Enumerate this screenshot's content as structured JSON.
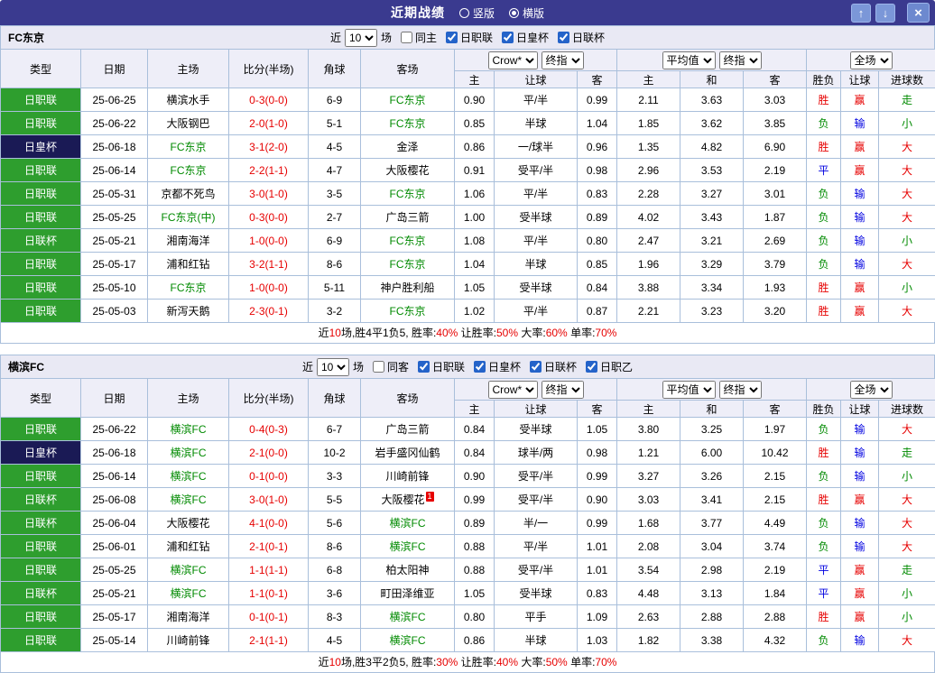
{
  "colors": {
    "red": "#e60000",
    "green": "#008a00",
    "blue": "#0000e0",
    "black": "#000000",
    "titlebar_bg": "#3a3a8f",
    "league_green_bg": "#2e9e2e",
    "league_dark_bg": "#1a1a55",
    "highlight_team": "#008a00"
  },
  "titlebar": {
    "title": "近期战绩",
    "layout_options": [
      {
        "label": "竖版",
        "selected": false
      },
      {
        "label": "横版",
        "selected": true
      }
    ],
    "up_icon": "↑",
    "down_icon": "↓",
    "close_icon": "×"
  },
  "table_headers": {
    "type": "类型",
    "date": "日期",
    "home": "主场",
    "score": "比分(半场)",
    "corner": "角球",
    "away": "客场",
    "odds_sub": [
      "主",
      "让球",
      "客"
    ],
    "avg_sub": [
      "主",
      "和",
      "客"
    ],
    "full_sub": [
      "胜负",
      "让球",
      "进球数"
    ]
  },
  "sections": [
    {
      "team": "FC东京",
      "filter": {
        "near_label": "近",
        "count": "10",
        "games_label": "场",
        "checkboxes": [
          {
            "label": "同主",
            "checked": false
          },
          {
            "label": "日职联",
            "checked": true
          },
          {
            "label": "日皇杯",
            "checked": true
          },
          {
            "label": "日联杯",
            "checked": true
          }
        ]
      },
      "selects": {
        "company": "Crow*",
        "company_mode": "终指",
        "avg": "平均值",
        "avg_mode": "终指",
        "scope": "全场"
      },
      "rows": [
        {
          "league": "日职联",
          "badge": "green",
          "date": "25-06-25",
          "home": "横滨水手",
          "home_hl": false,
          "score": "0-3(0-0)",
          "corner": "6-9",
          "away": "FC东京",
          "away_hl": true,
          "red": "",
          "odds": [
            "0.90",
            "平/半",
            "0.99"
          ],
          "avg": [
            "2.11",
            "3.63",
            "3.03"
          ],
          "results": [
            [
              "胜",
              "r"
            ],
            [
              "赢",
              "r"
            ],
            [
              "走",
              "g"
            ]
          ]
        },
        {
          "league": "日职联",
          "badge": "green",
          "date": "25-06-22",
          "home": "大阪钢巴",
          "home_hl": false,
          "score": "2-0(1-0)",
          "corner": "5-1",
          "away": "FC东京",
          "away_hl": true,
          "red": "",
          "odds": [
            "0.85",
            "半球",
            "1.04"
          ],
          "avg": [
            "1.85",
            "3.62",
            "3.85"
          ],
          "results": [
            [
              "负",
              "g"
            ],
            [
              "输",
              "b"
            ],
            [
              "小",
              "g"
            ]
          ]
        },
        {
          "league": "日皇杯",
          "badge": "dark",
          "date": "25-06-18",
          "home": "FC东京",
          "home_hl": true,
          "score": "3-1(2-0)",
          "corner": "4-5",
          "away": "金泽",
          "away_hl": false,
          "red": "",
          "odds": [
            "0.86",
            "一/球半",
            "0.96"
          ],
          "avg": [
            "1.35",
            "4.82",
            "6.90"
          ],
          "results": [
            [
              "胜",
              "r"
            ],
            [
              "赢",
              "r"
            ],
            [
              "大",
              "r"
            ]
          ]
        },
        {
          "league": "日职联",
          "badge": "green",
          "date": "25-06-14",
          "home": "FC东京",
          "home_hl": true,
          "score": "2-2(1-1)",
          "corner": "4-7",
          "away": "大阪樱花",
          "away_hl": false,
          "red": "",
          "odds": [
            "0.91",
            "受平/半",
            "0.98"
          ],
          "avg": [
            "2.96",
            "3.53",
            "2.19"
          ],
          "results": [
            [
              "平",
              "b"
            ],
            [
              "赢",
              "r"
            ],
            [
              "大",
              "r"
            ]
          ]
        },
        {
          "league": "日职联",
          "badge": "green",
          "date": "25-05-31",
          "home": "京都不死鸟",
          "home_hl": false,
          "score": "3-0(1-0)",
          "corner": "3-5",
          "away": "FC东京",
          "away_hl": true,
          "red": "",
          "odds": [
            "1.06",
            "平/半",
            "0.83"
          ],
          "avg": [
            "2.28",
            "3.27",
            "3.01"
          ],
          "results": [
            [
              "负",
              "g"
            ],
            [
              "输",
              "b"
            ],
            [
              "大",
              "r"
            ]
          ]
        },
        {
          "league": "日职联",
          "badge": "green",
          "date": "25-05-25",
          "home": "FC东京(中)",
          "home_hl": true,
          "score": "0-3(0-0)",
          "corner": "2-7",
          "away": "广岛三箭",
          "away_hl": false,
          "red": "",
          "odds": [
            "1.00",
            "受半球",
            "0.89"
          ],
          "avg": [
            "4.02",
            "3.43",
            "1.87"
          ],
          "results": [
            [
              "负",
              "g"
            ],
            [
              "输",
              "b"
            ],
            [
              "大",
              "r"
            ]
          ]
        },
        {
          "league": "日联杯",
          "badge": "green",
          "date": "25-05-21",
          "home": "湘南海洋",
          "home_hl": false,
          "score": "1-0(0-0)",
          "corner": "6-9",
          "away": "FC东京",
          "away_hl": true,
          "red": "",
          "odds": [
            "1.08",
            "平/半",
            "0.80"
          ],
          "avg": [
            "2.47",
            "3.21",
            "2.69"
          ],
          "results": [
            [
              "负",
              "g"
            ],
            [
              "输",
              "b"
            ],
            [
              "小",
              "g"
            ]
          ]
        },
        {
          "league": "日职联",
          "badge": "green",
          "date": "25-05-17",
          "home": "浦和红钻",
          "home_hl": false,
          "score": "3-2(1-1)",
          "corner": "8-6",
          "away": "FC东京",
          "away_hl": true,
          "red": "",
          "odds": [
            "1.04",
            "半球",
            "0.85"
          ],
          "avg": [
            "1.96",
            "3.29",
            "3.79"
          ],
          "results": [
            [
              "负",
              "g"
            ],
            [
              "输",
              "b"
            ],
            [
              "大",
              "r"
            ]
          ]
        },
        {
          "league": "日职联",
          "badge": "green",
          "date": "25-05-10",
          "home": "FC东京",
          "home_hl": true,
          "score": "1-0(0-0)",
          "corner": "5-11",
          "away": "神户胜利船",
          "away_hl": false,
          "red": "",
          "odds": [
            "1.05",
            "受半球",
            "0.84"
          ],
          "avg": [
            "3.88",
            "3.34",
            "1.93"
          ],
          "results": [
            [
              "胜",
              "r"
            ],
            [
              "赢",
              "r"
            ],
            [
              "小",
              "g"
            ]
          ]
        },
        {
          "league": "日职联",
          "badge": "green",
          "date": "25-05-03",
          "home": "新泻天鹅",
          "home_hl": false,
          "score": "2-3(0-1)",
          "corner": "3-2",
          "away": "FC东京",
          "away_hl": true,
          "red": "",
          "odds": [
            "1.02",
            "平/半",
            "0.87"
          ],
          "avg": [
            "2.21",
            "3.23",
            "3.20"
          ],
          "results": [
            [
              "胜",
              "r"
            ],
            [
              "赢",
              "r"
            ],
            [
              "大",
              "r"
            ]
          ]
        }
      ],
      "summary": [
        [
          "近",
          "k"
        ],
        [
          "10",
          "r"
        ],
        [
          "场,胜4平1负5, 胜率:",
          "k"
        ],
        [
          "40%",
          "r"
        ],
        [
          " 让胜率:",
          "k"
        ],
        [
          "50%",
          "r"
        ],
        [
          " 大率:",
          "k"
        ],
        [
          "60%",
          "r"
        ],
        [
          " 单率:",
          "k"
        ],
        [
          "70%",
          "r"
        ]
      ]
    },
    {
      "team": "横滨FC",
      "filter": {
        "near_label": "近",
        "count": "10",
        "games_label": "场",
        "checkboxes": [
          {
            "label": "同客",
            "checked": false
          },
          {
            "label": "日职联",
            "checked": true
          },
          {
            "label": "日皇杯",
            "checked": true
          },
          {
            "label": "日联杯",
            "checked": true
          },
          {
            "label": "日职乙",
            "checked": true
          }
        ]
      },
      "selects": {
        "company": "Crow*",
        "company_mode": "终指",
        "avg": "平均值",
        "avg_mode": "终指",
        "scope": "全场"
      },
      "rows": [
        {
          "league": "日职联",
          "badge": "green",
          "date": "25-06-22",
          "home": "横滨FC",
          "home_hl": true,
          "score": "0-4(0-3)",
          "corner": "6-7",
          "away": "广岛三箭",
          "away_hl": false,
          "red": "",
          "odds": [
            "0.84",
            "受半球",
            "1.05"
          ],
          "avg": [
            "3.80",
            "3.25",
            "1.97"
          ],
          "results": [
            [
              "负",
              "g"
            ],
            [
              "输",
              "b"
            ],
            [
              "大",
              "r"
            ]
          ]
        },
        {
          "league": "日皇杯",
          "badge": "dark",
          "date": "25-06-18",
          "home": "横滨FC",
          "home_hl": true,
          "score": "2-1(0-0)",
          "corner": "10-2",
          "away": "岩手盛冈仙鹤",
          "away_hl": false,
          "red": "",
          "odds": [
            "0.84",
            "球半/两",
            "0.98"
          ],
          "avg": [
            "1.21",
            "6.00",
            "10.42"
          ],
          "results": [
            [
              "胜",
              "r"
            ],
            [
              "输",
              "b"
            ],
            [
              "走",
              "g"
            ]
          ]
        },
        {
          "league": "日职联",
          "badge": "green",
          "date": "25-06-14",
          "home": "横滨FC",
          "home_hl": true,
          "score": "0-1(0-0)",
          "corner": "3-3",
          "away": "川崎前锋",
          "away_hl": false,
          "red": "",
          "odds": [
            "0.90",
            "受平/半",
            "0.99"
          ],
          "avg": [
            "3.27",
            "3.26",
            "2.15"
          ],
          "results": [
            [
              "负",
              "g"
            ],
            [
              "输",
              "b"
            ],
            [
              "小",
              "g"
            ]
          ]
        },
        {
          "league": "日联杯",
          "badge": "green",
          "date": "25-06-08",
          "home": "横滨FC",
          "home_hl": true,
          "score": "3-0(1-0)",
          "corner": "5-5",
          "away": "大阪樱花",
          "away_hl": false,
          "red": "1",
          "odds": [
            "0.99",
            "受平/半",
            "0.90"
          ],
          "avg": [
            "3.03",
            "3.41",
            "2.15"
          ],
          "results": [
            [
              "胜",
              "r"
            ],
            [
              "赢",
              "r"
            ],
            [
              "大",
              "r"
            ]
          ]
        },
        {
          "league": "日联杯",
          "badge": "green",
          "date": "25-06-04",
          "home": "大阪樱花",
          "home_hl": false,
          "score": "4-1(0-0)",
          "corner": "5-6",
          "away": "横滨FC",
          "away_hl": true,
          "red": "",
          "odds": [
            "0.89",
            "半/一",
            "0.99"
          ],
          "avg": [
            "1.68",
            "3.77",
            "4.49"
          ],
          "results": [
            [
              "负",
              "g"
            ],
            [
              "输",
              "b"
            ],
            [
              "大",
              "r"
            ]
          ]
        },
        {
          "league": "日职联",
          "badge": "green",
          "date": "25-06-01",
          "home": "浦和红钻",
          "home_hl": false,
          "score": "2-1(0-1)",
          "corner": "8-6",
          "away": "横滨FC",
          "away_hl": true,
          "red": "",
          "odds": [
            "0.88",
            "平/半",
            "1.01"
          ],
          "avg": [
            "2.08",
            "3.04",
            "3.74"
          ],
          "results": [
            [
              "负",
              "g"
            ],
            [
              "输",
              "b"
            ],
            [
              "大",
              "r"
            ]
          ]
        },
        {
          "league": "日职联",
          "badge": "green",
          "date": "25-05-25",
          "home": "横滨FC",
          "home_hl": true,
          "score": "1-1(1-1)",
          "corner": "6-8",
          "away": "柏太阳神",
          "away_hl": false,
          "red": "",
          "odds": [
            "0.88",
            "受平/半",
            "1.01"
          ],
          "avg": [
            "3.54",
            "2.98",
            "2.19"
          ],
          "results": [
            [
              "平",
              "b"
            ],
            [
              "赢",
              "r"
            ],
            [
              "走",
              "g"
            ]
          ]
        },
        {
          "league": "日联杯",
          "badge": "green",
          "date": "25-05-21",
          "home": "横滨FC",
          "home_hl": true,
          "score": "1-1(0-1)",
          "corner": "3-6",
          "away": "町田泽维亚",
          "away_hl": false,
          "red": "",
          "odds": [
            "1.05",
            "受半球",
            "0.83"
          ],
          "avg": [
            "4.48",
            "3.13",
            "1.84"
          ],
          "results": [
            [
              "平",
              "b"
            ],
            [
              "赢",
              "r"
            ],
            [
              "小",
              "g"
            ]
          ]
        },
        {
          "league": "日职联",
          "badge": "green",
          "date": "25-05-17",
          "home": "湘南海洋",
          "home_hl": false,
          "score": "0-1(0-1)",
          "corner": "8-3",
          "away": "横滨FC",
          "away_hl": true,
          "red": "",
          "odds": [
            "0.80",
            "平手",
            "1.09"
          ],
          "avg": [
            "2.63",
            "2.88",
            "2.88"
          ],
          "results": [
            [
              "胜",
              "r"
            ],
            [
              "赢",
              "r"
            ],
            [
              "小",
              "g"
            ]
          ]
        },
        {
          "league": "日职联",
          "badge": "green",
          "date": "25-05-14",
          "home": "川崎前锋",
          "home_hl": false,
          "score": "2-1(1-1)",
          "corner": "4-5",
          "away": "横滨FC",
          "away_hl": true,
          "red": "",
          "odds": [
            "0.86",
            "半球",
            "1.03"
          ],
          "avg": [
            "1.82",
            "3.38",
            "4.32"
          ],
          "results": [
            [
              "负",
              "g"
            ],
            [
              "输",
              "b"
            ],
            [
              "大",
              "r"
            ]
          ]
        }
      ],
      "summary": [
        [
          "近",
          "k"
        ],
        [
          "10",
          "r"
        ],
        [
          "场,胜3平2负5, 胜率:",
          "k"
        ],
        [
          "30%",
          "r"
        ],
        [
          " 让胜率:",
          "k"
        ],
        [
          "40%",
          "r"
        ],
        [
          " 大率:",
          "k"
        ],
        [
          "50%",
          "r"
        ],
        [
          " 单率:",
          "k"
        ],
        [
          "70%",
          "r"
        ]
      ]
    }
  ]
}
